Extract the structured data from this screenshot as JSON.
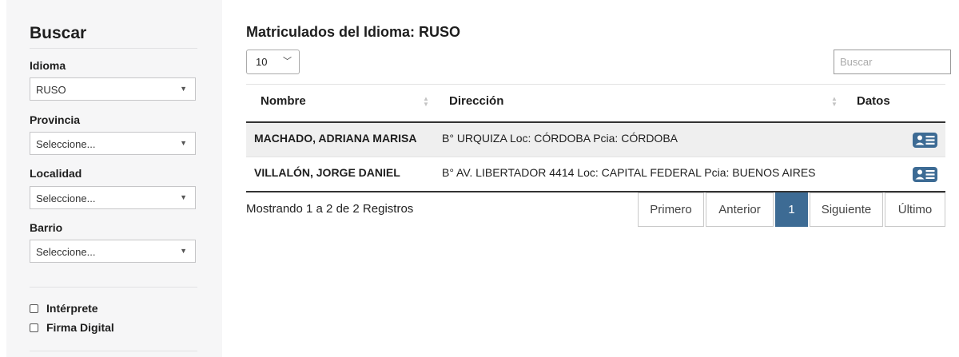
{
  "sidebar": {
    "title": "Buscar",
    "fields": [
      {
        "label": "Idioma",
        "value": "RUSO"
      },
      {
        "label": "Provincia",
        "value": "Seleccione..."
      },
      {
        "label": "Localidad",
        "value": "Seleccione..."
      },
      {
        "label": "Barrio",
        "value": "Seleccione..."
      }
    ],
    "checkboxes": [
      {
        "label": "Intérprete",
        "checked": false
      },
      {
        "label": "Firma Digital",
        "checked": false
      }
    ]
  },
  "main": {
    "title": "Matriculados del Idioma: RUSO",
    "page_length": "10",
    "search_placeholder": "Buscar",
    "columns": [
      "Nombre",
      "Dirección",
      "Datos"
    ],
    "rows": [
      {
        "nombre": "MACHADO, ADRIANA MARISA",
        "direccion": "B° URQUIZA Loc: CÓRDOBA Pcia: CÓRDOBA"
      },
      {
        "nombre": "VILLALÓN, JORGE DANIEL",
        "direccion": "B° AV. LIBERTADOR 4414 Loc: CAPITAL FEDERAL Pcia: BUENOS AIRES"
      }
    ],
    "row_action_icon": "contact-card-icon",
    "info": "Mostrando 1 a 2 de 2 Registros",
    "pagination": {
      "first": "Primero",
      "prev": "Anterior",
      "current": "1",
      "next": "Siguiente",
      "last": "Último"
    }
  },
  "colors": {
    "accent": "#3d6b94",
    "sidebar_bg": "#f6f6f7",
    "icon": "#3d6b94"
  }
}
